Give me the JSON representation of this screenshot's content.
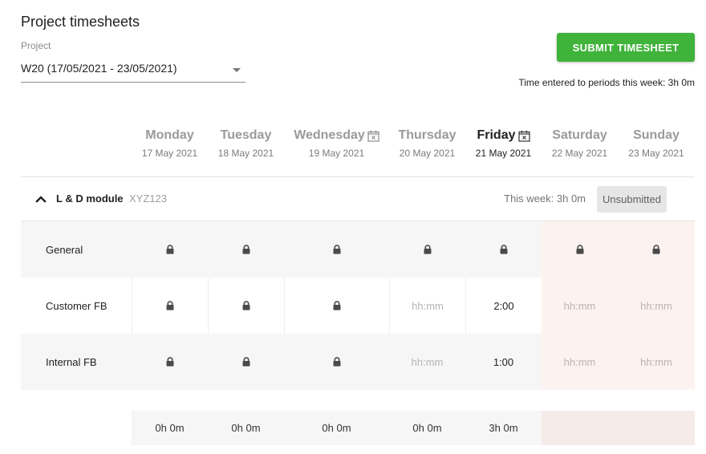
{
  "header": {
    "title": "Project timesheets",
    "project_label": "Project",
    "project_value": "W20 (17/05/2021 - 23/05/2021)",
    "submit_label": "SUBMIT TIMESHEET",
    "week_time": "Time entered to periods this week: 3h 0m"
  },
  "colors": {
    "accent": "#3fb33a",
    "weekend_bg": "#fcf3f0",
    "row_shaded": "#f6f6f6"
  },
  "days": [
    {
      "name": "Monday",
      "date": "17 May 2021",
      "icon": null,
      "today": false,
      "weekend": false
    },
    {
      "name": "Tuesday",
      "date": "18 May 2021",
      "icon": null,
      "today": false,
      "weekend": false
    },
    {
      "name": "Wednesday",
      "date": "19 May 2021",
      "icon": "calendar-x-icon",
      "today": false,
      "weekend": false
    },
    {
      "name": "Thursday",
      "date": "20 May 2021",
      "icon": null,
      "today": false,
      "weekend": false
    },
    {
      "name": "Friday",
      "date": "21 May 2021",
      "icon": "calendar-x-icon",
      "today": true,
      "weekend": false
    },
    {
      "name": "Saturday",
      "date": "22 May 2021",
      "icon": null,
      "today": false,
      "weekend": true
    },
    {
      "name": "Sunday",
      "date": "23 May 2021",
      "icon": null,
      "today": false,
      "weekend": true
    }
  ],
  "group": {
    "expand_icon": "chevron-up-icon",
    "name": "L & D module",
    "code": "XYZ123",
    "week_total": "This week: 3h 0m",
    "status": "Unsubmitted"
  },
  "rows": [
    {
      "label": "General",
      "cells": [
        {
          "type": "locked"
        },
        {
          "type": "locked"
        },
        {
          "type": "locked"
        },
        {
          "type": "locked"
        },
        {
          "type": "locked"
        },
        {
          "type": "locked"
        },
        {
          "type": "locked"
        }
      ]
    },
    {
      "label": "Customer FB",
      "cells": [
        {
          "type": "locked"
        },
        {
          "type": "locked"
        },
        {
          "type": "locked"
        },
        {
          "type": "input",
          "value": "",
          "placeholder": "hh:mm"
        },
        {
          "type": "input",
          "value": "2:00",
          "placeholder": "hh:mm"
        },
        {
          "type": "input",
          "value": "",
          "placeholder": "hh:mm"
        },
        {
          "type": "input",
          "value": "",
          "placeholder": "hh:mm"
        }
      ]
    },
    {
      "label": "Internal FB",
      "cells": [
        {
          "type": "locked"
        },
        {
          "type": "locked"
        },
        {
          "type": "locked"
        },
        {
          "type": "input",
          "value": "",
          "placeholder": "hh:mm"
        },
        {
          "type": "input",
          "value": "1:00",
          "placeholder": "hh:mm"
        },
        {
          "type": "input",
          "value": "",
          "placeholder": "hh:mm"
        },
        {
          "type": "input",
          "value": "",
          "placeholder": "hh:mm"
        }
      ]
    }
  ],
  "totals": [
    "0h 0m",
    "0h 0m",
    "0h 0m",
    "0h 0m",
    "3h 0m",
    "",
    ""
  ]
}
